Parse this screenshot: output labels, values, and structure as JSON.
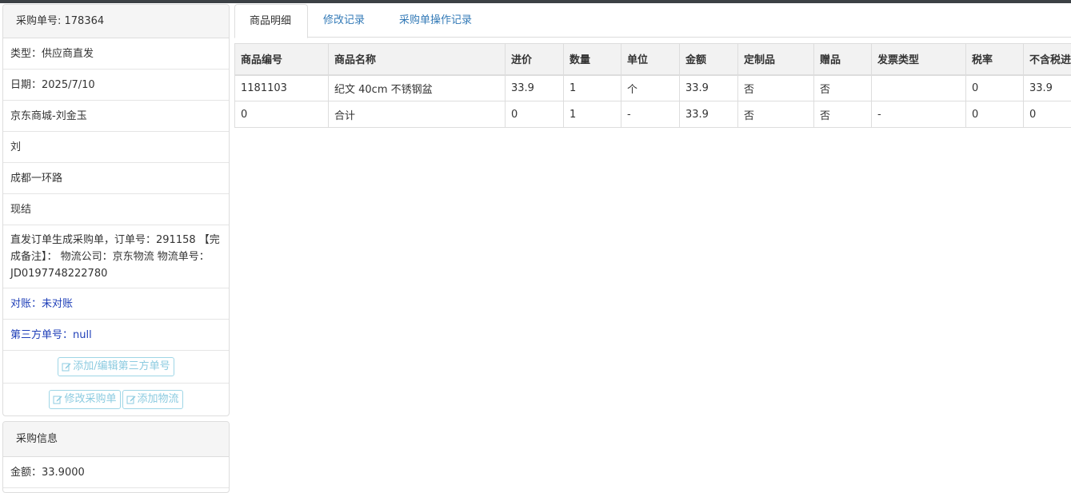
{
  "left_panel": {
    "heading": "采购单号: 178364",
    "rows": [
      "类型：供应商直发",
      "日期：2025/7/10",
      "京东商城-刘金玉",
      "刘",
      "成都一环路",
      "现结",
      "直发订单生成采购单，订单号：291158 【完成备注】： 物流公司：京东物流 物流单号：JD0197748222780",
      "对账：未对账",
      "第三方单号：null"
    ],
    "buttons": {
      "edit_third_party": "添加/编辑第三方单号",
      "edit_order": "修改采购单",
      "add_logistics": "添加物流"
    }
  },
  "purchase_panel": {
    "heading": "采购信息",
    "amount": "金额：33.9000"
  },
  "tabs": [
    "商品明细",
    "修改记录",
    "采购单操作记录"
  ],
  "table": {
    "headers": [
      "商品编号",
      "商品名称",
      "进价",
      "数量",
      "单位",
      "金额",
      "定制品",
      "赠品",
      "发票类型",
      "税率",
      "不含税进价"
    ],
    "rows": [
      [
        "1181103",
        "纪文 40cm 不锈钢盆",
        "33.9",
        "1",
        "个",
        "33.9",
        "否",
        "否",
        "",
        "0",
        "33.9"
      ],
      [
        "0",
        "合计",
        "0",
        "1",
        "-",
        "33.9",
        "否",
        "否",
        "-",
        "0",
        "0"
      ]
    ]
  },
  "colors": {
    "link": "#1f3fb8",
    "tab_link": "#337ab7",
    "button_border": "#9fd6e6",
    "button_text": "#8ccbe0"
  },
  "icons": {
    "button_icon": "edit-icon"
  }
}
